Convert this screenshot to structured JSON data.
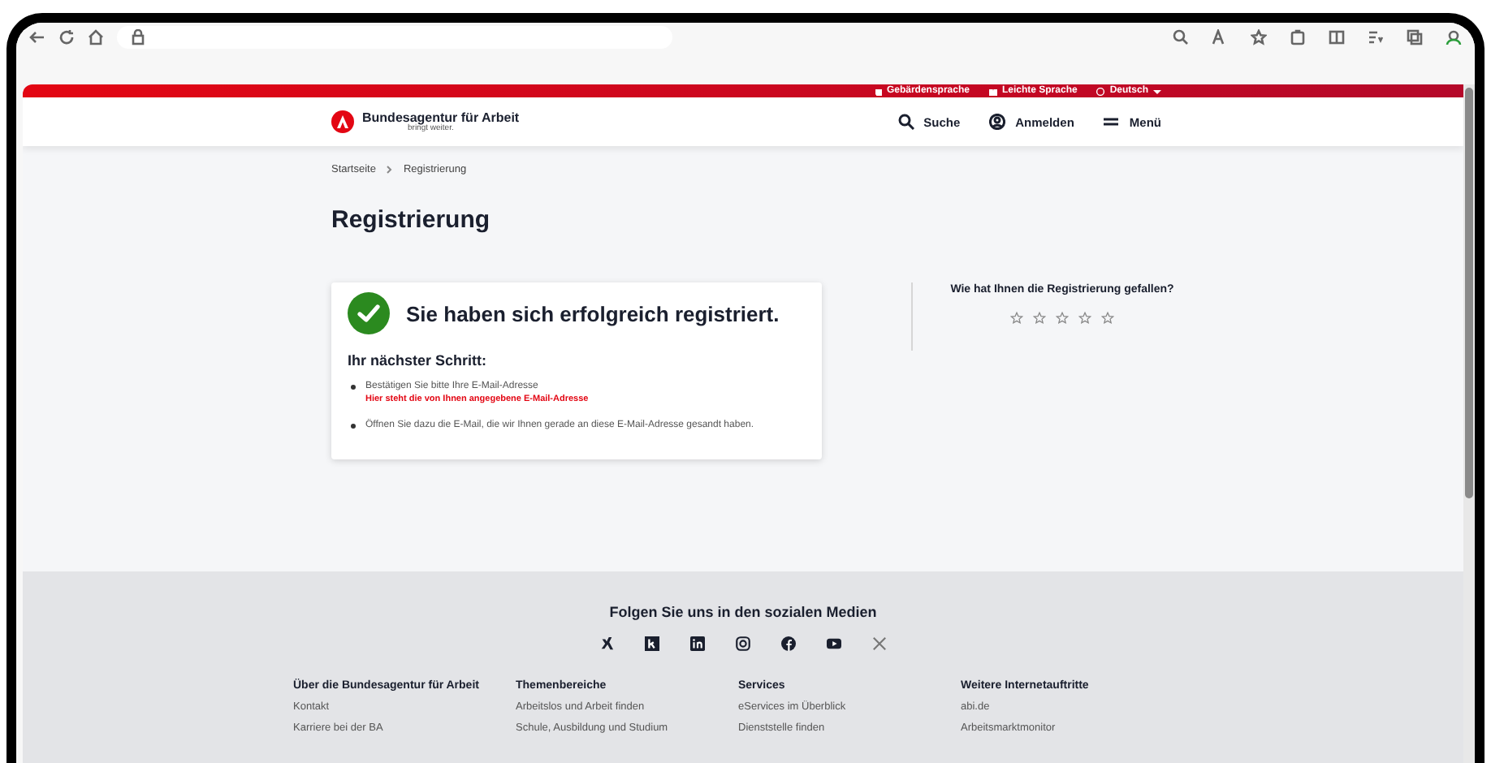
{
  "top_bar": {
    "links": [
      {
        "label": "Gebärdensprache"
      },
      {
        "label": "Leichte Sprache"
      },
      {
        "label": "Deutsch",
        "dropdown": true
      }
    ]
  },
  "header": {
    "logo_title": "Bundesagentur für Arbeit",
    "logo_tagline": "bringt weiter.",
    "nav": [
      {
        "label": "Suche"
      },
      {
        "label": "Anmelden"
      },
      {
        "label": "Menü"
      }
    ]
  },
  "breadcrumb": [
    "Startseite",
    "Registrierung"
  ],
  "title": "Registrierung",
  "confirmation": {
    "heading": "Sie haben sich erfolgreich registriert.",
    "subheading": "Ihr nächster Schritt:",
    "steps": [
      {
        "text": "Bestätigen Sie bitte Ihre E-Mail-Adresse",
        "note": "Hier steht die von Ihnen angegebene E-Mail-Adresse"
      },
      {
        "text": "Öffnen Sie dazu die E-Mail, die wir Ihnen gerade an diese E-Mail-Adresse gesandt haben."
      }
    ]
  },
  "rating": {
    "question": "Wie hat Ihnen die Registrierung gefallen?",
    "stars": 0
  },
  "footer": {
    "social_title": "Folgen Sie uns in den sozialen Medien",
    "columns": [
      {
        "heading": "Über die Bundesagentur für Arbeit",
        "links": [
          "Kontakt",
          "Karriere bei der BA"
        ]
      },
      {
        "heading": "Themenbereiche",
        "links": [
          "Arbeitslos und Arbeit finden",
          "Schule, Ausbildung und Studium"
        ]
      },
      {
        "heading": "Services",
        "links": [
          "eServices im Überblick",
          "Dienststelle finden"
        ]
      },
      {
        "heading": "Weitere Internetauftritte",
        "links": [
          "abi.de",
          "Arbeitsmarktmonitor"
        ]
      }
    ]
  }
}
